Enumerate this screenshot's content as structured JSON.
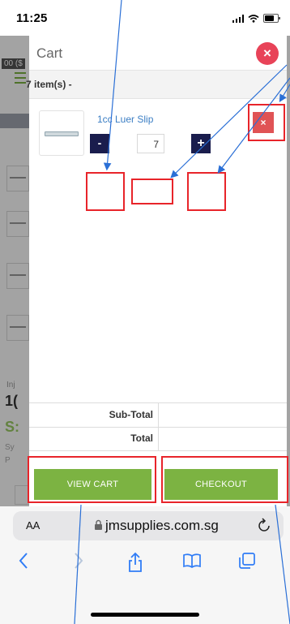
{
  "status_bar": {
    "time": "11:25"
  },
  "background_page": {
    "price_fragment": "00 ($",
    "text_a": "Inj",
    "text_b": "1(",
    "text_c": "S:",
    "text_d": "Sy",
    "text_e": "P"
  },
  "cart": {
    "title": "Cart",
    "close_symbol": "×",
    "items_count": "7 item(s) -",
    "items": [
      {
        "name": "1cc Luer Slip",
        "quantity": "7",
        "minus_label": "-",
        "plus_label": "+",
        "remove_label": "×"
      }
    ],
    "totals": {
      "subtotal_label": "Sub-Total",
      "subtotal_value": "",
      "total_label": "Total",
      "total_value": ""
    },
    "view_cart_label": "VIEW CART",
    "checkout_label": "CHECKOUT"
  },
  "browser": {
    "text_size_label": "AA",
    "url": "jmsupplies.com.sg",
    "lock_icon": "lock-icon",
    "reload_icon": "reload-icon"
  },
  "toolbar": {
    "back_icon": "chevron-left-icon",
    "forward_icon": "chevron-right-icon",
    "share_icon": "share-icon",
    "bookmarks_icon": "book-icon",
    "tabs_icon": "tabs-icon"
  },
  "colors": {
    "accent_green": "#7cb342",
    "navy_button": "#1a1d4d",
    "close_red": "#e84358",
    "annotation_red": "#e8242a",
    "annotation_blue": "#2a6fd6",
    "link_blue": "#3b7ec4"
  }
}
